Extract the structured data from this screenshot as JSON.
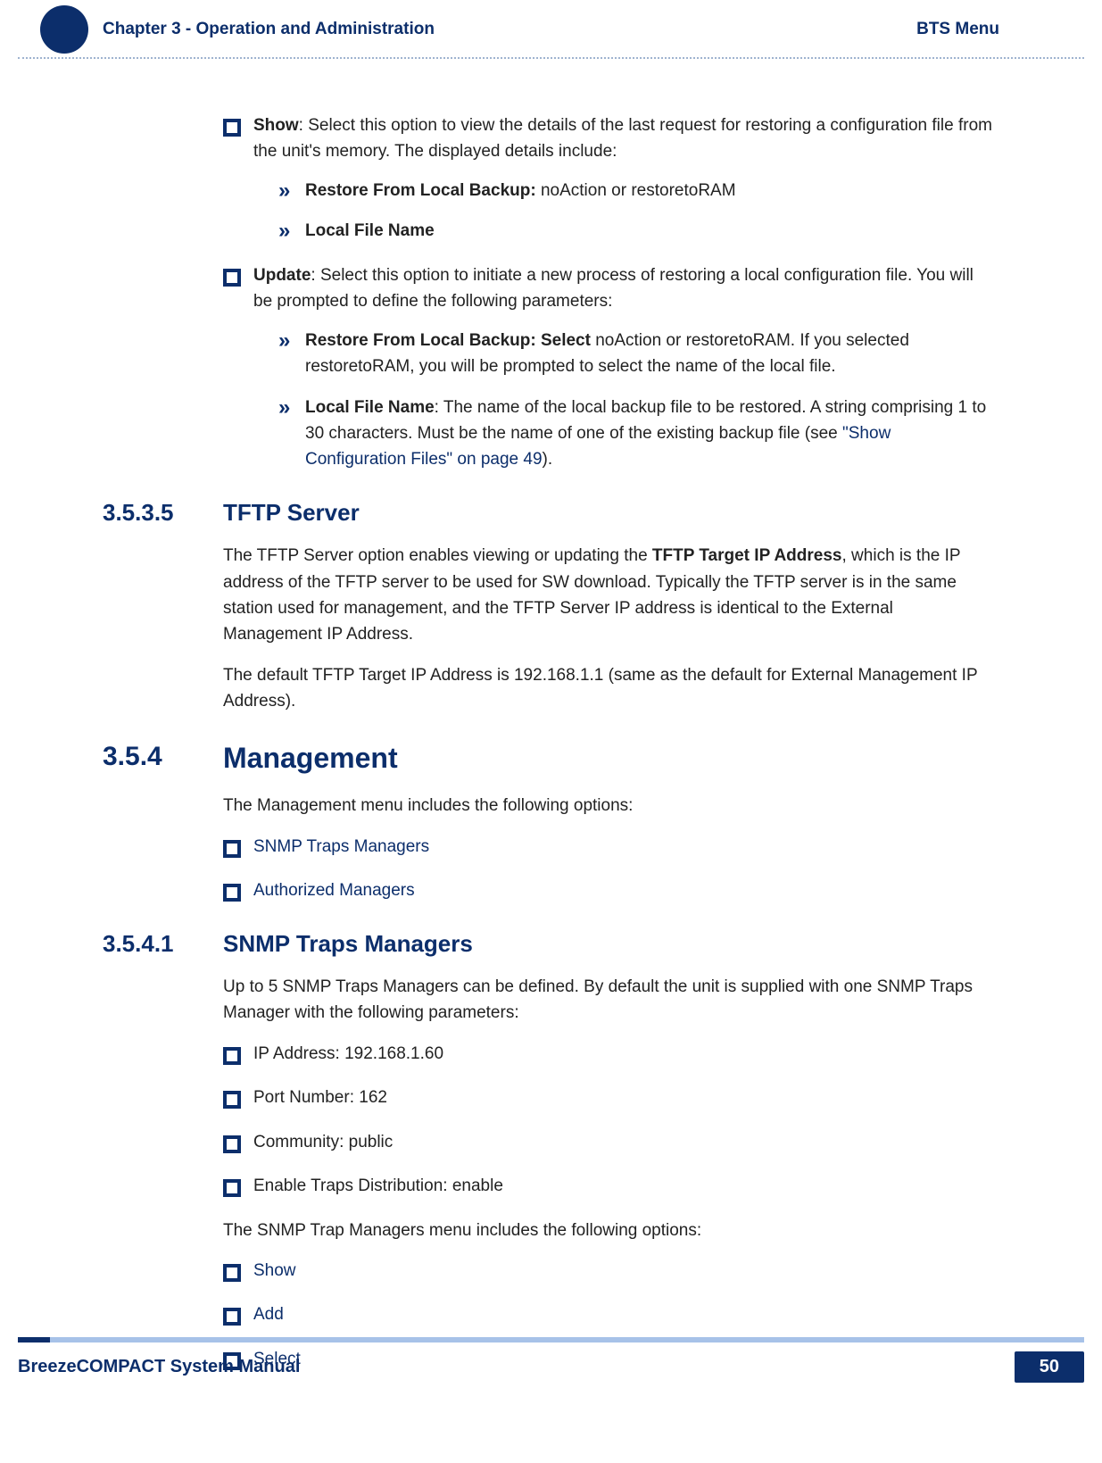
{
  "header": {
    "chapter": "Chapter 3 - Operation and Administration",
    "menu": "BTS Menu"
  },
  "body": {
    "show": {
      "label": "Show",
      "text": ": Select this option to view the details of the last request for restoring a configuration file from the unit's memory. The displayed details include:",
      "sub1_label": "Restore From Local Backup:",
      "sub1_text": " noAction or restoretoRAM",
      "sub2_label": "Local File Name"
    },
    "update": {
      "label": "Update",
      "text": ": Select this option to initiate a new process of restoring a local configuration file. You will be prompted to define the following parameters:",
      "sub1_label": "Restore From Local Backup: Select",
      "sub1_text": " noAction or restoretoRAM. If you selected restoretoRAM, you will be prompted to select the name of the local file.",
      "sub2_label": "Local File Name",
      "sub2_text_a": ": The name of the local backup file to be restored. A string comprising 1 to 30 characters. Must be the name of one of the existing backup file (see ",
      "sub2_link": "\"Show Configuration Files\" on page 49",
      "sub2_text_b": ")."
    },
    "sec_3535": {
      "num": "3.5.3.5",
      "title": "TFTP Server"
    },
    "tftp_p1_a": "The TFTP Server option enables viewing or updating the ",
    "tftp_p1_bold": "TFTP Target IP Address",
    "tftp_p1_b": ", which is the IP address of the TFTP server to be used for SW download. Typically the TFTP server is in the same station used for management, and the TFTP Server IP address is identical to the External Management IP Address.",
    "tftp_p2": "The default TFTP Target IP Address is 192.168.1.1 (same as the default for External Management IP Address).",
    "sec_354": {
      "num": "3.5.4",
      "title": "Management"
    },
    "mgmt_intro": "The Management menu includes the following options:",
    "mgmt_opts": [
      "SNMP Traps Managers",
      "Authorized Managers"
    ],
    "sec_3541": {
      "num": "3.5.4.1",
      "title": "SNMP Traps Managers"
    },
    "snmp_intro": "Up to 5 SNMP Traps Managers can be defined. By default the unit is supplied with one SNMP Traps Manager with the following parameters:",
    "snmp_params": [
      "IP Address: 192.168.1.60",
      "Port Number: 162",
      "Community: public",
      "Enable Traps Distribution: enable"
    ],
    "snmp_menu_intro": "The SNMP Trap Managers menu includes the following options:",
    "snmp_menu": [
      "Show",
      "Add",
      "Select"
    ]
  },
  "footer": {
    "manual": "BreezeCOMPACT System Manual",
    "page": "50"
  }
}
